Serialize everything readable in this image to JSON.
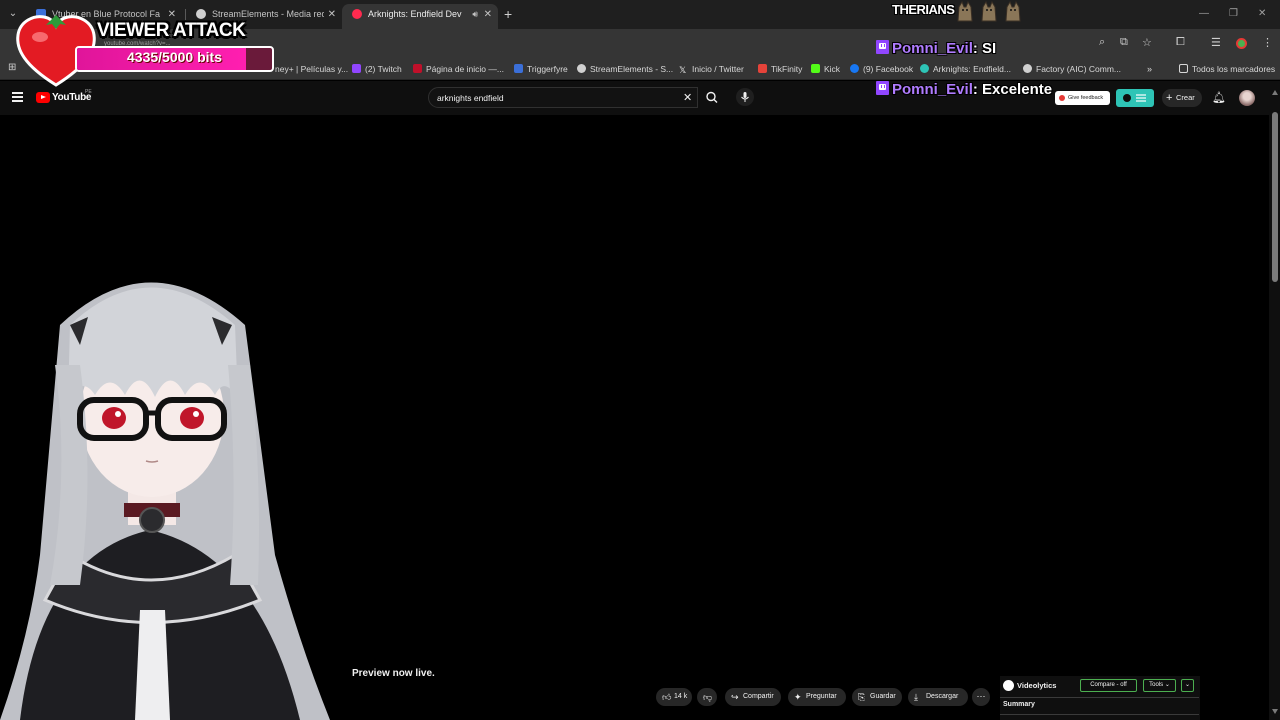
{
  "browser": {
    "tabs": [
      {
        "title": "Vtuber en Blue Protocol Farme...",
        "favicon_color": "#3b6fd8"
      },
      {
        "title": "StreamElements - Media reque...",
        "favicon_color": "#d0d0d0"
      },
      {
        "title": "Arknights: Endfield Dev Log...",
        "favicon_color": "#ff2a4f",
        "active": true
      }
    ],
    "bookmarks": [
      {
        "label": "ney+ | Películas y...",
        "color": "#1f3b8c"
      },
      {
        "label": "(2) Twitch",
        "color": "#9146ff"
      },
      {
        "label": "Página de inicio —...",
        "color": "#c0102a"
      },
      {
        "label": "Triggerfyre",
        "color": "#3b6fd8"
      },
      {
        "label": "StreamElements - S...",
        "color": "#d0d0d0"
      },
      {
        "label": "Inicio / Twitter",
        "color": "#f1f1f1"
      },
      {
        "label": "TikFinity",
        "color": "#e5433a"
      },
      {
        "label": "Kick",
        "color": "#53fc18"
      },
      {
        "label": "(9) Facebook",
        "color": "#1877f2"
      },
      {
        "label": "Arknights: Endfield...",
        "color": "#2ec4b6"
      },
      {
        "label": "Factory (AIC) Comm...",
        "color": "#d0d0d0"
      }
    ],
    "all_bookmarks": "Todos los marcadores"
  },
  "youtube": {
    "logo_text": "YouTube",
    "region": "PE",
    "search_value": "arknights endfield",
    "feedback_label": "Give feedback",
    "create_label": "Crear",
    "preview_text": "Preview now live.",
    "actions": {
      "likes": "14 k",
      "share": "Compartir",
      "ask": "Preguntar",
      "save": "Guardar",
      "download": "Descargar"
    },
    "videolytics": {
      "name": "Videolytics",
      "compare": "Compare - off",
      "tools": "Tools",
      "summary": "Summary"
    }
  },
  "overlay": {
    "viewer_attack": {
      "title": "VIEWER ATTACK",
      "bits_text": "4335/5000 bits",
      "progress_fraction": 0.867,
      "url_text": "youtube.com/watch?v=..."
    },
    "therians_text": "THERIANS",
    "chat": [
      {
        "user": "Pomni_Evil",
        "message": ": SI"
      },
      {
        "user": "Pomni_Evil",
        "message": ": Excelente"
      }
    ]
  }
}
